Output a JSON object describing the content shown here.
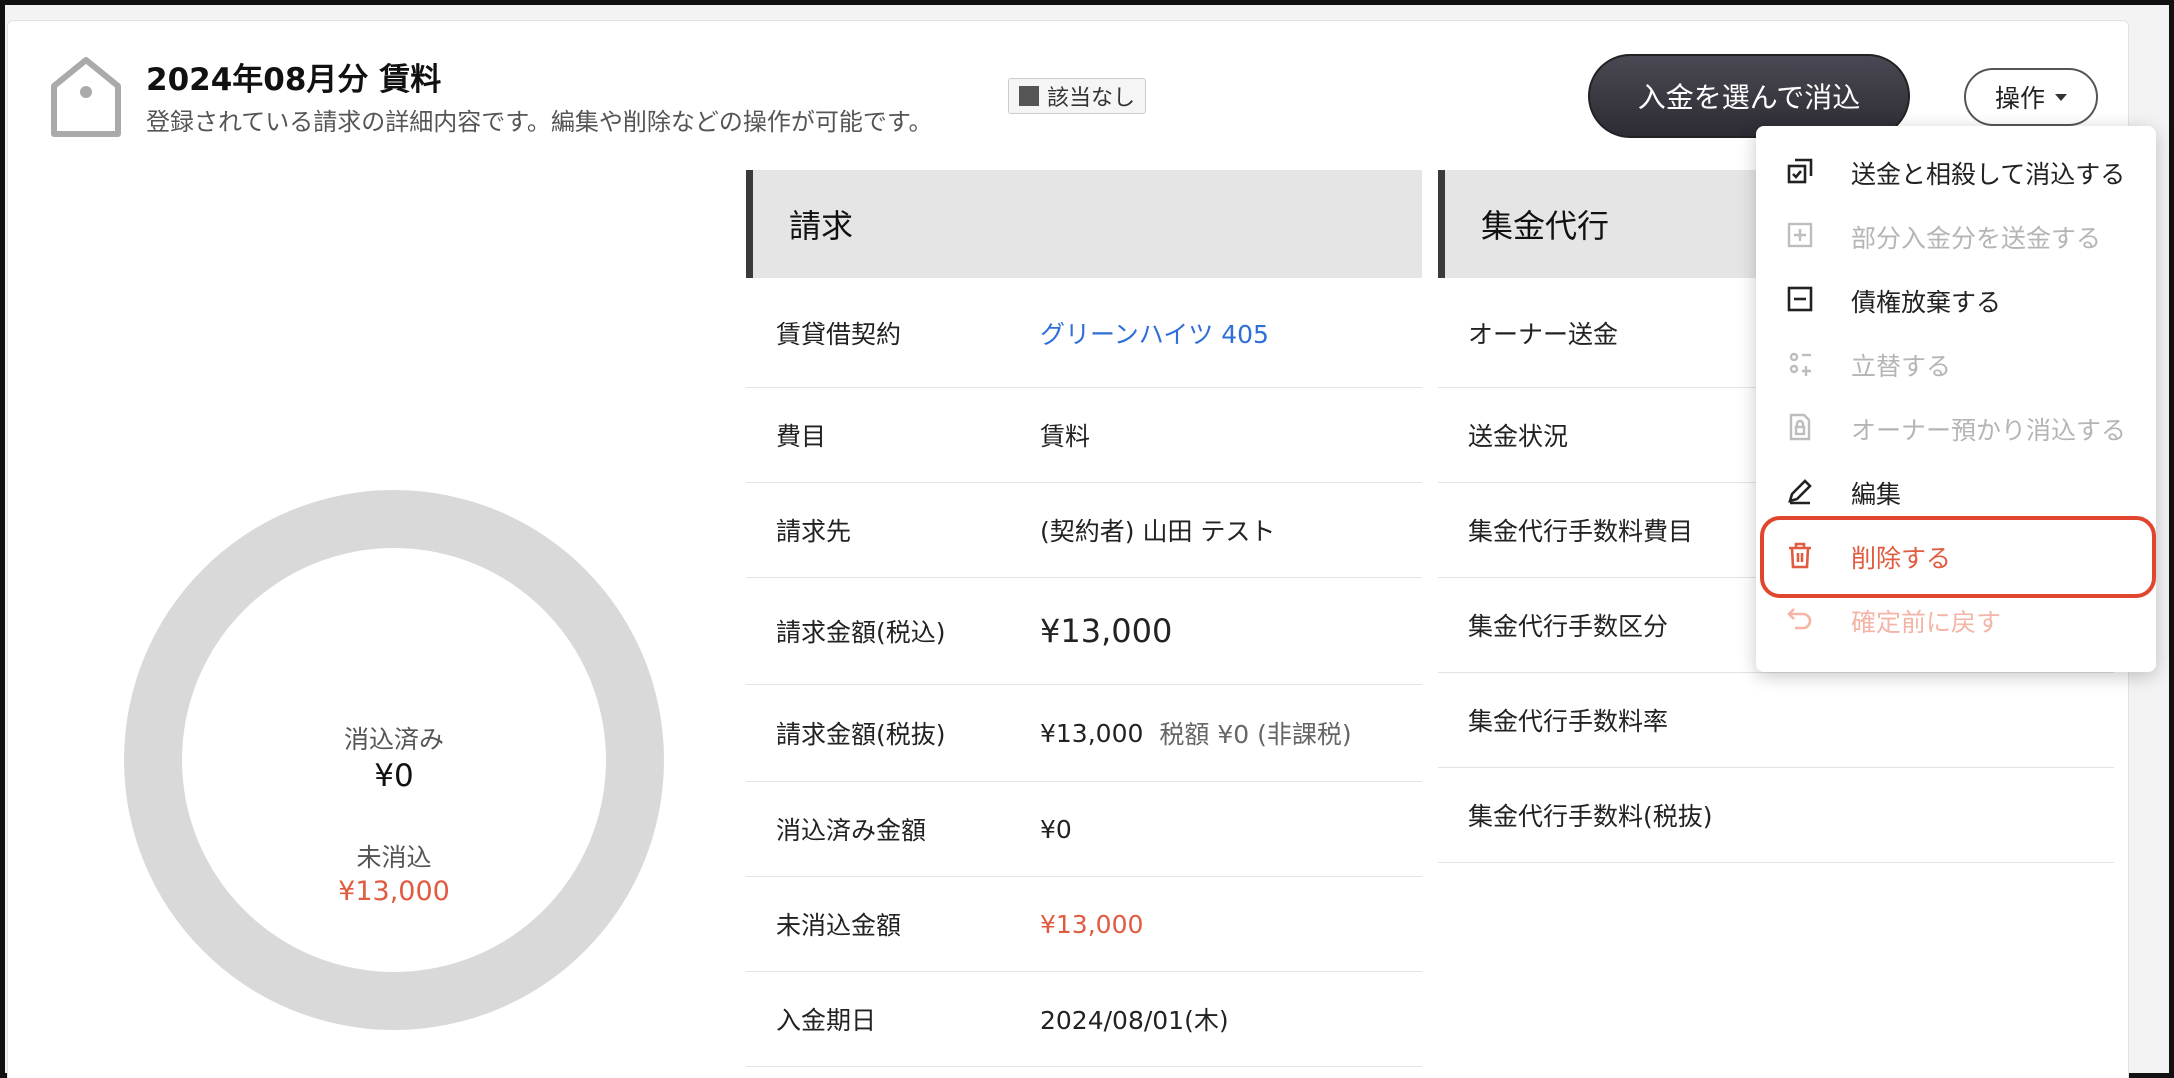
{
  "header": {
    "title": "2024年08月分 賃料",
    "subtitle": "登録されている請求の詳細内容です。編集や削除などの操作が可能です。",
    "badge": "該当なし",
    "primary_button": "入金を選んで消込",
    "ops_button": "操作"
  },
  "donut": {
    "settled_label": "消込済み",
    "settled_value": "¥0",
    "unsettled_label": "未消込",
    "unsettled_value": "¥13,000",
    "settled_fraction": 0
  },
  "billing": {
    "heading": "請求",
    "rows": [
      {
        "key": "賃貸借契約",
        "value": "グリーンハイツ 405"
      },
      {
        "key": "費目",
        "value": "賃料"
      },
      {
        "key": "請求先",
        "value": "(契約者) 山田 テスト"
      },
      {
        "key": "請求金額(税込)",
        "value": "¥13,000"
      },
      {
        "key": "請求金額(税抜)",
        "value": "¥13,000",
        "extra": "税額 ¥0 (非課税)"
      },
      {
        "key": "消込済み金額",
        "value": "¥0"
      },
      {
        "key": "未消込金額",
        "value": "¥13,000"
      },
      {
        "key": "入金期日",
        "value": "2024/08/01(木)"
      }
    ]
  },
  "collection": {
    "heading": "集金代行",
    "rows": [
      {
        "key": "オーナー送金"
      },
      {
        "key": "送金状況"
      },
      {
        "key": "集金代行手数料費目"
      },
      {
        "key": "集金代行手数区分"
      },
      {
        "key": "集金代行手数料率"
      },
      {
        "key": "集金代行手数料(税抜)"
      }
    ]
  },
  "menu": {
    "items": [
      {
        "label": "送金と相殺して消込する",
        "icon": "offset-icon",
        "enabled": true
      },
      {
        "label": "部分入金分を送金する",
        "icon": "plus-square-icon",
        "enabled": false
      },
      {
        "label": "債権放棄する",
        "icon": "minus-square-icon",
        "enabled": true
      },
      {
        "label": "立替する",
        "icon": "advance-icon",
        "enabled": false
      },
      {
        "label": "オーナー預かり消込する",
        "icon": "lock-document-icon",
        "enabled": false
      },
      {
        "label": "編集",
        "icon": "pencil-icon",
        "enabled": true
      },
      {
        "label": "削除する",
        "icon": "trash-icon",
        "enabled": true
      },
      {
        "label": "確定前に戻す",
        "icon": "undo-icon",
        "enabled": false
      }
    ]
  },
  "colors": {
    "accent_red": "#e05b3f",
    "link_blue": "#2f6fd7",
    "highlight_border": "#e0452e"
  }
}
